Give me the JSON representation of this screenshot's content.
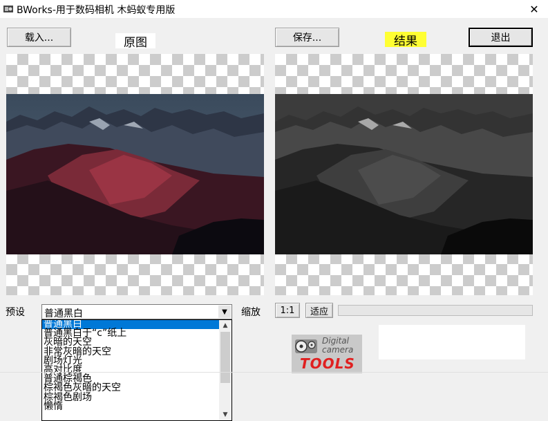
{
  "window": {
    "title": "BWorks-用于数码相机 木蚂蚁专用版",
    "close_glyph": "✕"
  },
  "toolbar": {
    "load_label": "载入...",
    "save_label": "保存...",
    "exit_label": "退出"
  },
  "labels": {
    "original": "原图",
    "result": "结果",
    "preset": "预设",
    "zoom": "缩放"
  },
  "zoom_controls": {
    "one_to_one": "1:1",
    "fit": "适应"
  },
  "preset": {
    "selected": "普通黑白",
    "options": [
      "普通黑白",
      "普通黑白于“c”纸上",
      "灰暗的天空",
      "非常灰暗的天空",
      "剧场灯光",
      "高对比度",
      "普通棕褐色",
      "棕褐色灰暗的天空",
      "棕褐色剧场",
      "懒惰"
    ]
  },
  "logo": {
    "line1": "Digital",
    "line2": "camera",
    "brand": "TOOLS"
  },
  "colors": {
    "result_label_bg": "#ffff33",
    "selection": "#0078d7",
    "logo_red": "#e02020"
  }
}
